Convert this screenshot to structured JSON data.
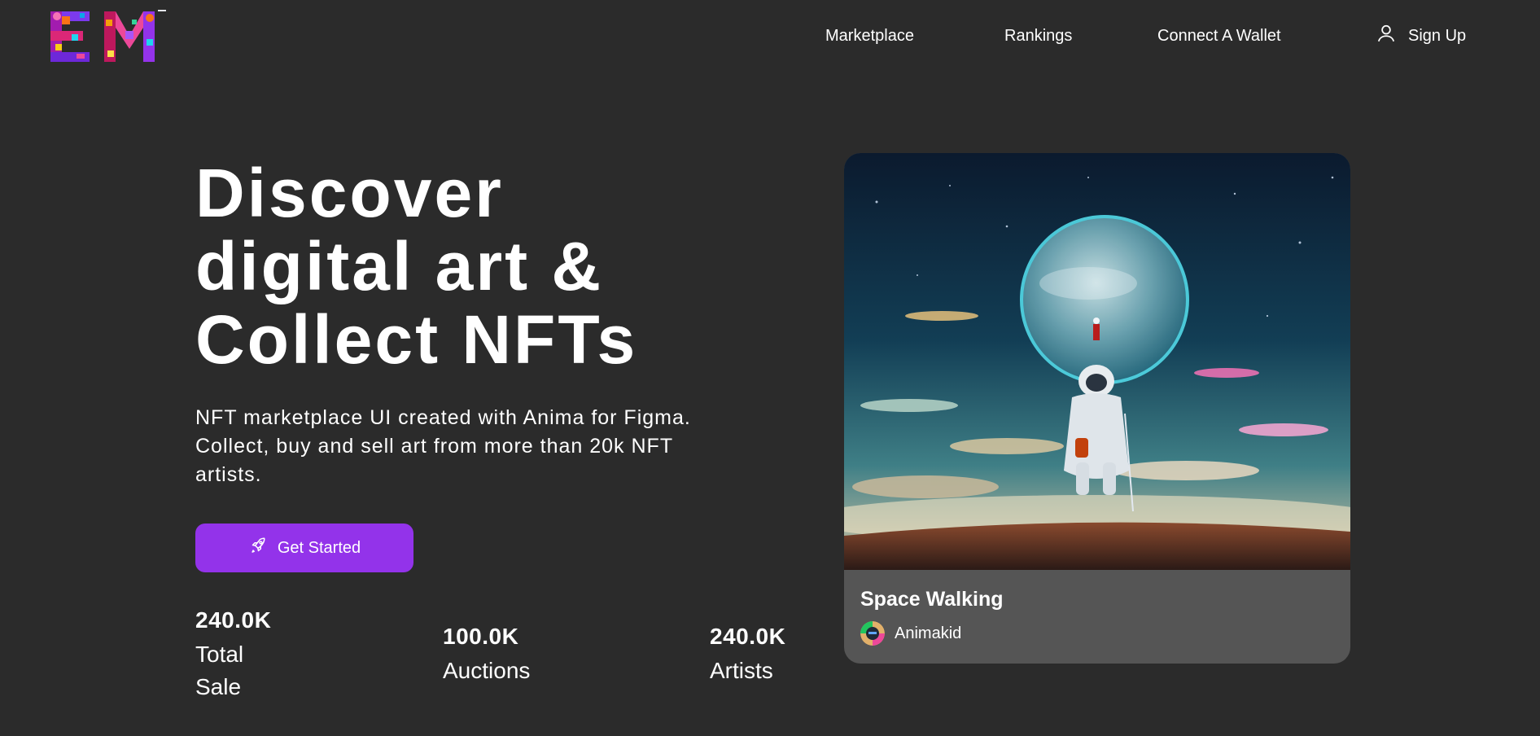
{
  "header": {
    "logo_text": "EM",
    "nav": {
      "marketplace": "Marketplace",
      "rankings": "Rankings",
      "connect_wallet": "Connect A Wallet",
      "sign_up": "Sign Up"
    }
  },
  "hero": {
    "title_lines": [
      "Discover",
      "digital art &",
      "Collect NFTs"
    ],
    "description": "NFT marketplace UI created with Anima for Figma. Collect, buy and sell art from more than 20k NFT artists.",
    "cta_label": "Get Started"
  },
  "stats": [
    {
      "value": "240.0K",
      "label": "Total Sale"
    },
    {
      "value": "100.0K",
      "label": "Auctions"
    },
    {
      "value": "240.0K",
      "label": "Artists"
    }
  ],
  "featured": {
    "title": "Space Walking",
    "artist": "Animakid"
  },
  "colors": {
    "background": "#2b2b2b",
    "accent": "#9333ea",
    "card": "#555555",
    "text": "#ffffff"
  },
  "icons": {
    "user": "user-icon",
    "rocket": "rocket-icon"
  }
}
